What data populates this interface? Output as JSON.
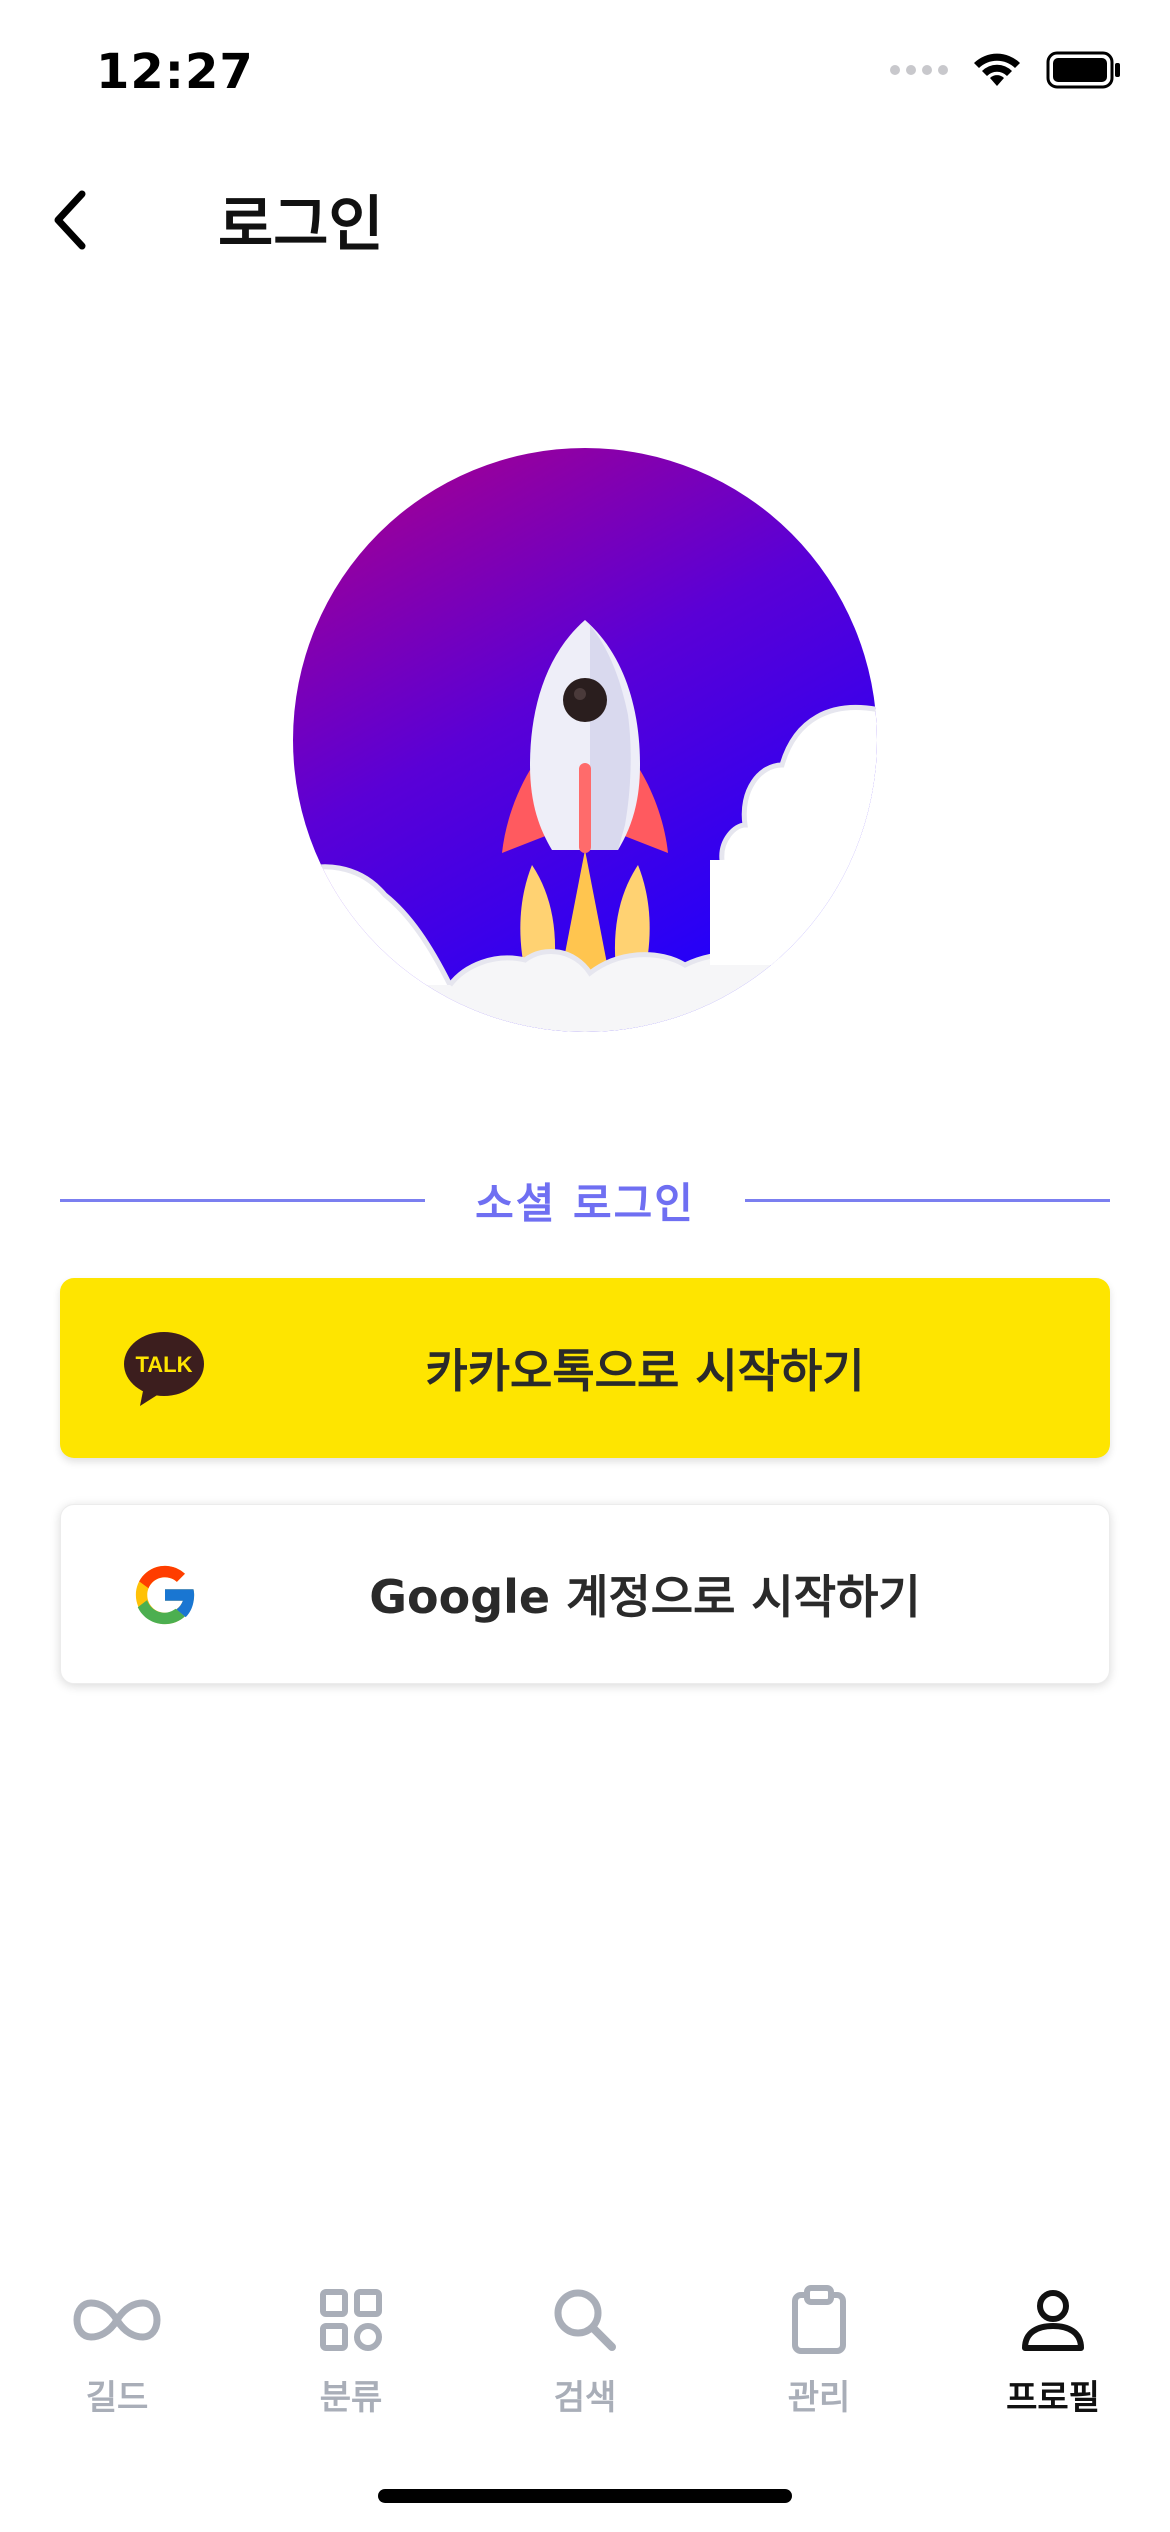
{
  "status_bar": {
    "time": "12:27"
  },
  "header": {
    "title": "로그인"
  },
  "social": {
    "divider_label": "소셜 로그인"
  },
  "buttons": {
    "kakao_label": "카카오톡으로 시작하기",
    "kakao_icon_text": "TALK",
    "google_label": "Google 계정으로 시작하기"
  },
  "tabs": [
    {
      "label": "길드",
      "icon": "infinity-icon",
      "active": false
    },
    {
      "label": "분류",
      "icon": "grid-icon",
      "active": false
    },
    {
      "label": "검색",
      "icon": "search-icon",
      "active": false
    },
    {
      "label": "관리",
      "icon": "clipboard-icon",
      "active": false
    },
    {
      "label": "프로필",
      "icon": "person-icon",
      "active": true
    }
  ],
  "colors": {
    "accent": "#6f6ff2",
    "kakao_yellow": "#FEE500",
    "tab_inactive": "#a9aeb8",
    "tab_active": "#111111"
  }
}
